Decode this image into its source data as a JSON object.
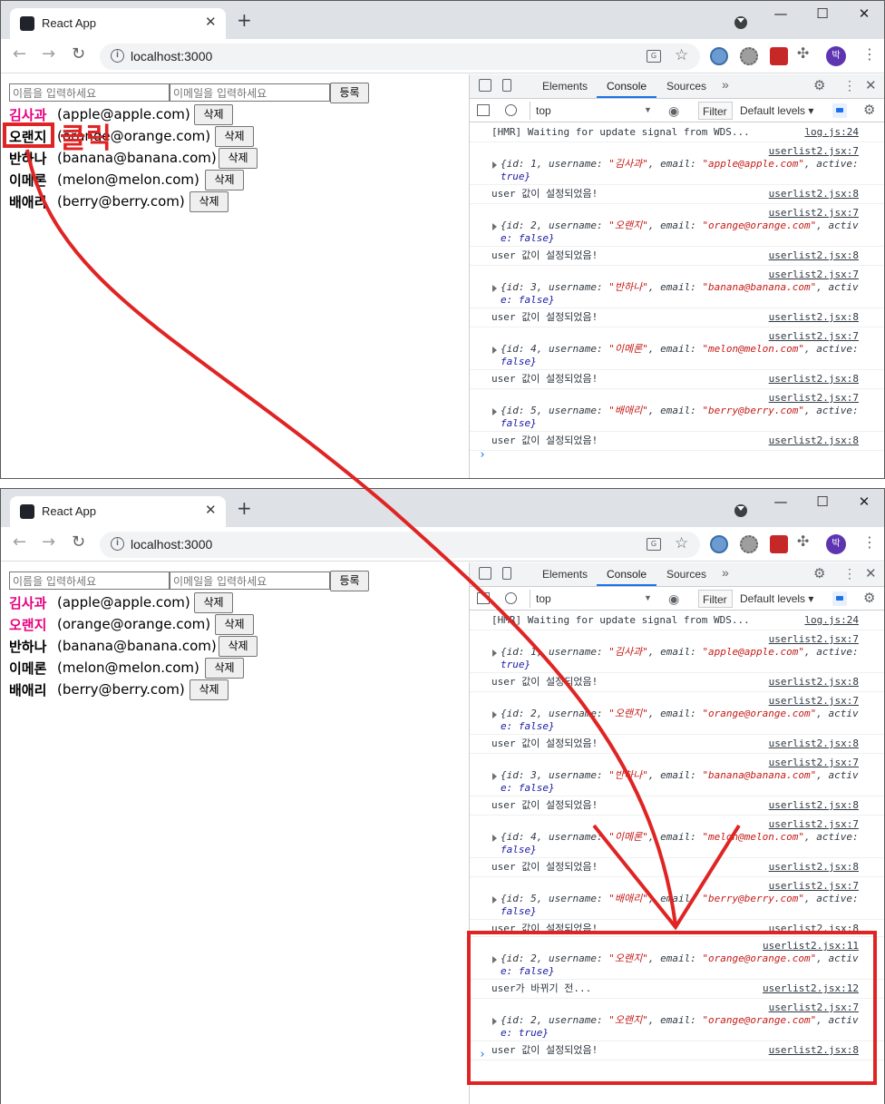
{
  "browser": {
    "tab_title": "React App",
    "url": "localhost:3000",
    "profile_initial": "박"
  },
  "app": {
    "name_placeholder": "이름을 입력하세요",
    "email_placeholder": "이메일을 입력하세요",
    "register_label": "등록",
    "delete_label": "삭제",
    "users_before": [
      {
        "username": "김사과",
        "email": "(apple@apple.com)",
        "active": true
      },
      {
        "username": "오랜지",
        "email": "(orange@orange.com)",
        "active": false
      },
      {
        "username": "반하나",
        "email": "(banana@banana.com)",
        "active": false
      },
      {
        "username": "이메론",
        "email": "(melon@melon.com)",
        "active": false
      },
      {
        "username": "배애리",
        "email": "(berry@berry.com)",
        "active": false
      }
    ],
    "users_after": [
      {
        "username": "김사과",
        "email": "(apple@apple.com)",
        "active": true
      },
      {
        "username": "오랜지",
        "email": "(orange@orange.com)",
        "active": true
      },
      {
        "username": "반하나",
        "email": "(banana@banana.com)",
        "active": false
      },
      {
        "username": "이메론",
        "email": "(melon@melon.com)",
        "active": false
      },
      {
        "username": "배애리",
        "email": "(berry@berry.com)",
        "active": false
      }
    ],
    "active_color": "#e6007e",
    "inactive_color": "#000000"
  },
  "devtools": {
    "tabs": [
      "Elements",
      "Console",
      "Sources"
    ],
    "active_tab": "Console",
    "context": "top",
    "filter_placeholder": "Filter",
    "levels": "Default levels ▾",
    "hmr_message": "[HMR] Waiting for update signal from WDS...",
    "hmr_source": "log.js:24",
    "set_message": "user 값이 설정되었음!",
    "obj_source": "userlist2.jsx:7",
    "set_source": "userlist2.jsx:8",
    "objects": [
      {
        "prefix": "{id: 1, username: ",
        "username": "\"김사과\"",
        "mid": ", email: ",
        "email": "\"apple@apple.com\"",
        "tail": ", active:",
        "line2": "true}"
      },
      {
        "prefix": "{id: 2, username: ",
        "username": "\"오랜지\"",
        "mid": ", email: ",
        "email": "\"orange@orange.com\"",
        "tail": ", activ",
        "line2": "e: false}"
      },
      {
        "prefix": "{id: 3, username: ",
        "username": "\"반하나\"",
        "mid": ", email: ",
        "email": "\"banana@banana.com\"",
        "tail": ", activ",
        "line2": "e: false}"
      },
      {
        "prefix": "{id: 4, username: ",
        "username": "\"이메론\"",
        "mid": ", email: ",
        "email": "\"melon@melon.com\"",
        "tail": ", active:",
        "line2": "false}"
      },
      {
        "prefix": "{id: 5, username: ",
        "username": "\"배애리\"",
        "mid": ", email: ",
        "email": "\"berry@berry.com\"",
        "tail": ", active:",
        "line2": "false}"
      }
    ],
    "extra": {
      "obj_before_source": "userlist2.jsx:11",
      "obj_before": {
        "prefix": "{id: 2, username: ",
        "username": "\"오랜지\"",
        "mid": ", email: ",
        "email": "\"orange@orange.com\"",
        "tail": ", activ",
        "line2": "e: false}"
      },
      "change_message": "user가 바뀌기 전...",
      "change_source": "userlist2.jsx:12",
      "obj_after_source": "userlist2.jsx:7",
      "obj_after": {
        "prefix": "{id: 2, username: ",
        "username": "\"오랜지\"",
        "mid": ", email: ",
        "email": "\"orange@orange.com\"",
        "tail": ", activ",
        "line2": "e: true}"
      },
      "set_message": "user 값이 설정되었음!",
      "set_source": "userlist2.jsx:8"
    }
  },
  "annotation": {
    "click_label": "클릭",
    "color": "#e02424"
  }
}
